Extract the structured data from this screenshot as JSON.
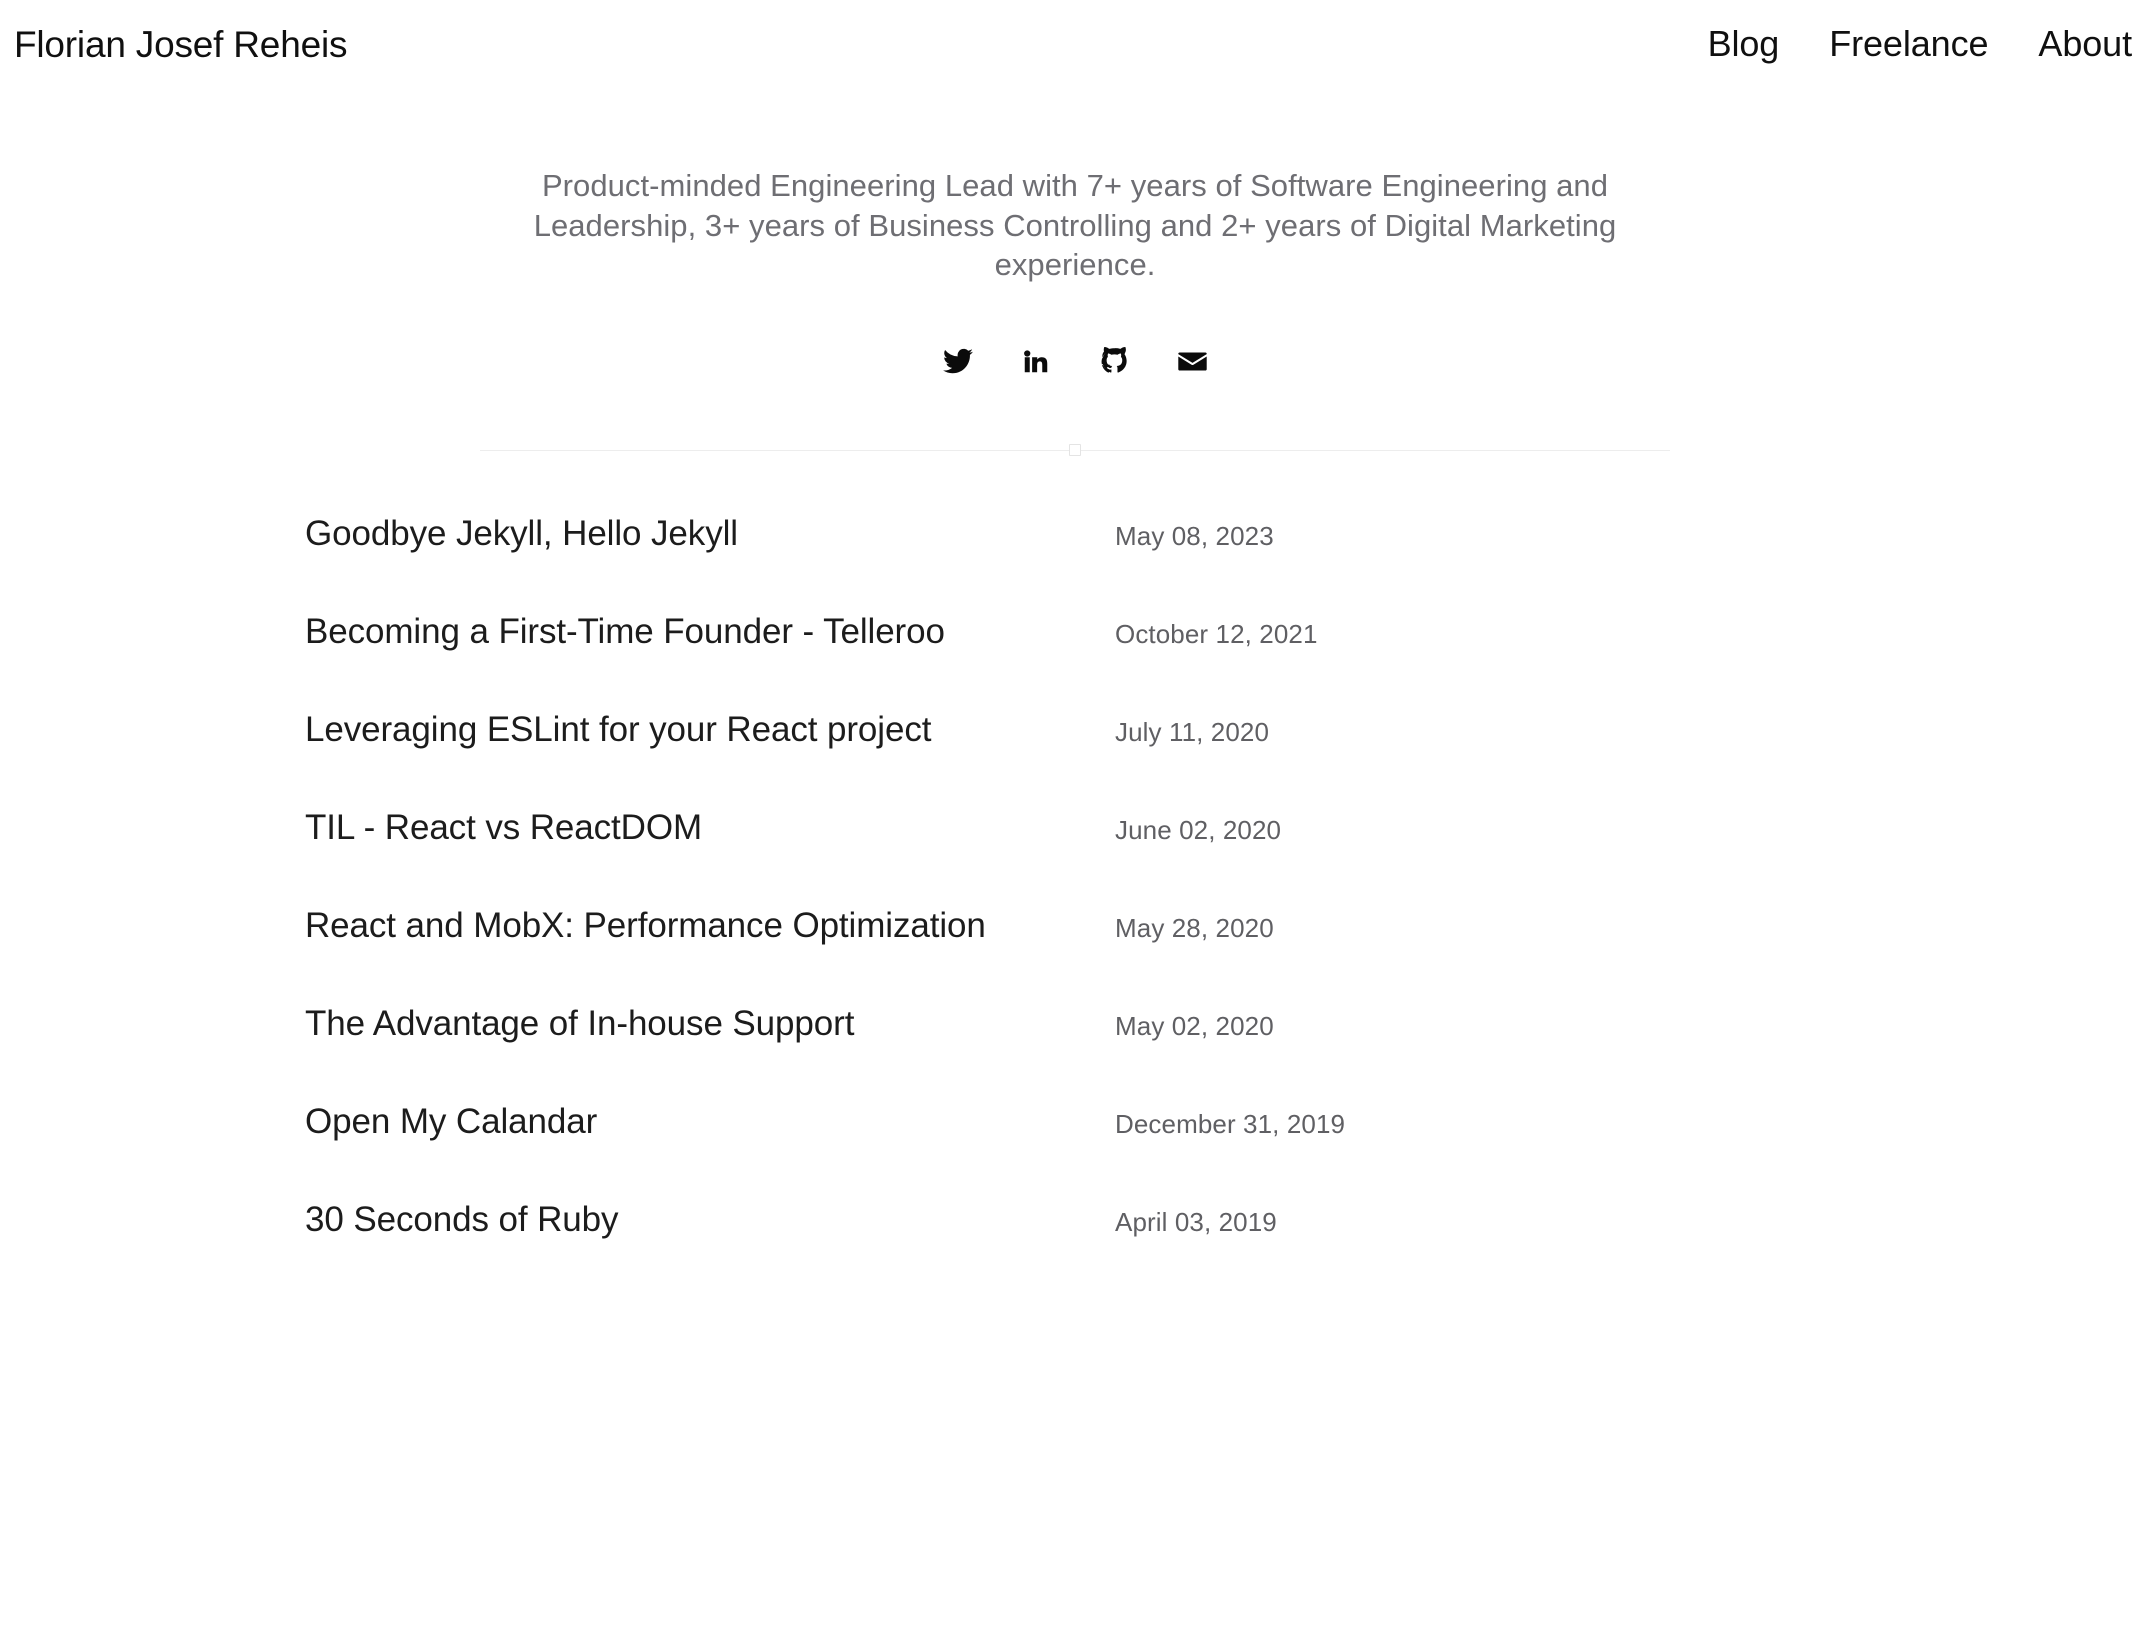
{
  "header": {
    "brand": "Florian Josef Reheis",
    "nav": [
      {
        "label": "Blog",
        "name": "nav-link-blog"
      },
      {
        "label": "Freelance",
        "name": "nav-link-freelance"
      },
      {
        "label": "About",
        "name": "nav-link-about"
      }
    ]
  },
  "intro": {
    "tagline": "Product-minded Engineering Lead with 7+ years of Software Engineering and Leadership, 3+ years of Business Controlling and 2+ years of Digital Marketing experience."
  },
  "social": [
    {
      "icon": "twitter-icon",
      "label": "Twitter"
    },
    {
      "icon": "linkedin-icon",
      "label": "LinkedIn"
    },
    {
      "icon": "github-icon",
      "label": "GitHub"
    },
    {
      "icon": "email-icon",
      "label": "Email"
    }
  ],
  "posts": [
    {
      "title": "Goodbye Jekyll, Hello Jekyll",
      "date": "May 08, 2023"
    },
    {
      "title": "Becoming a First-Time Founder - Telleroo",
      "date": "October 12, 2021"
    },
    {
      "title": "Leveraging ESLint for your React project",
      "date": "July 11, 2020"
    },
    {
      "title": "TIL - React vs ReactDOM",
      "date": "June 02, 2020"
    },
    {
      "title": "React and MobX: Performance Optimization",
      "date": "May 28, 2020"
    },
    {
      "title": "The Advantage of In-house Support",
      "date": "May 02, 2020"
    },
    {
      "title": "Open My Calandar",
      "date": "December 31, 2019"
    },
    {
      "title": "30 Seconds of Ruby",
      "date": "April 03, 2019"
    }
  ],
  "colors": {
    "text": "#1a1a1a",
    "muted": "#6e6e73",
    "date": "#5f5f63",
    "rule": "#ededed",
    "background": "#ffffff"
  }
}
